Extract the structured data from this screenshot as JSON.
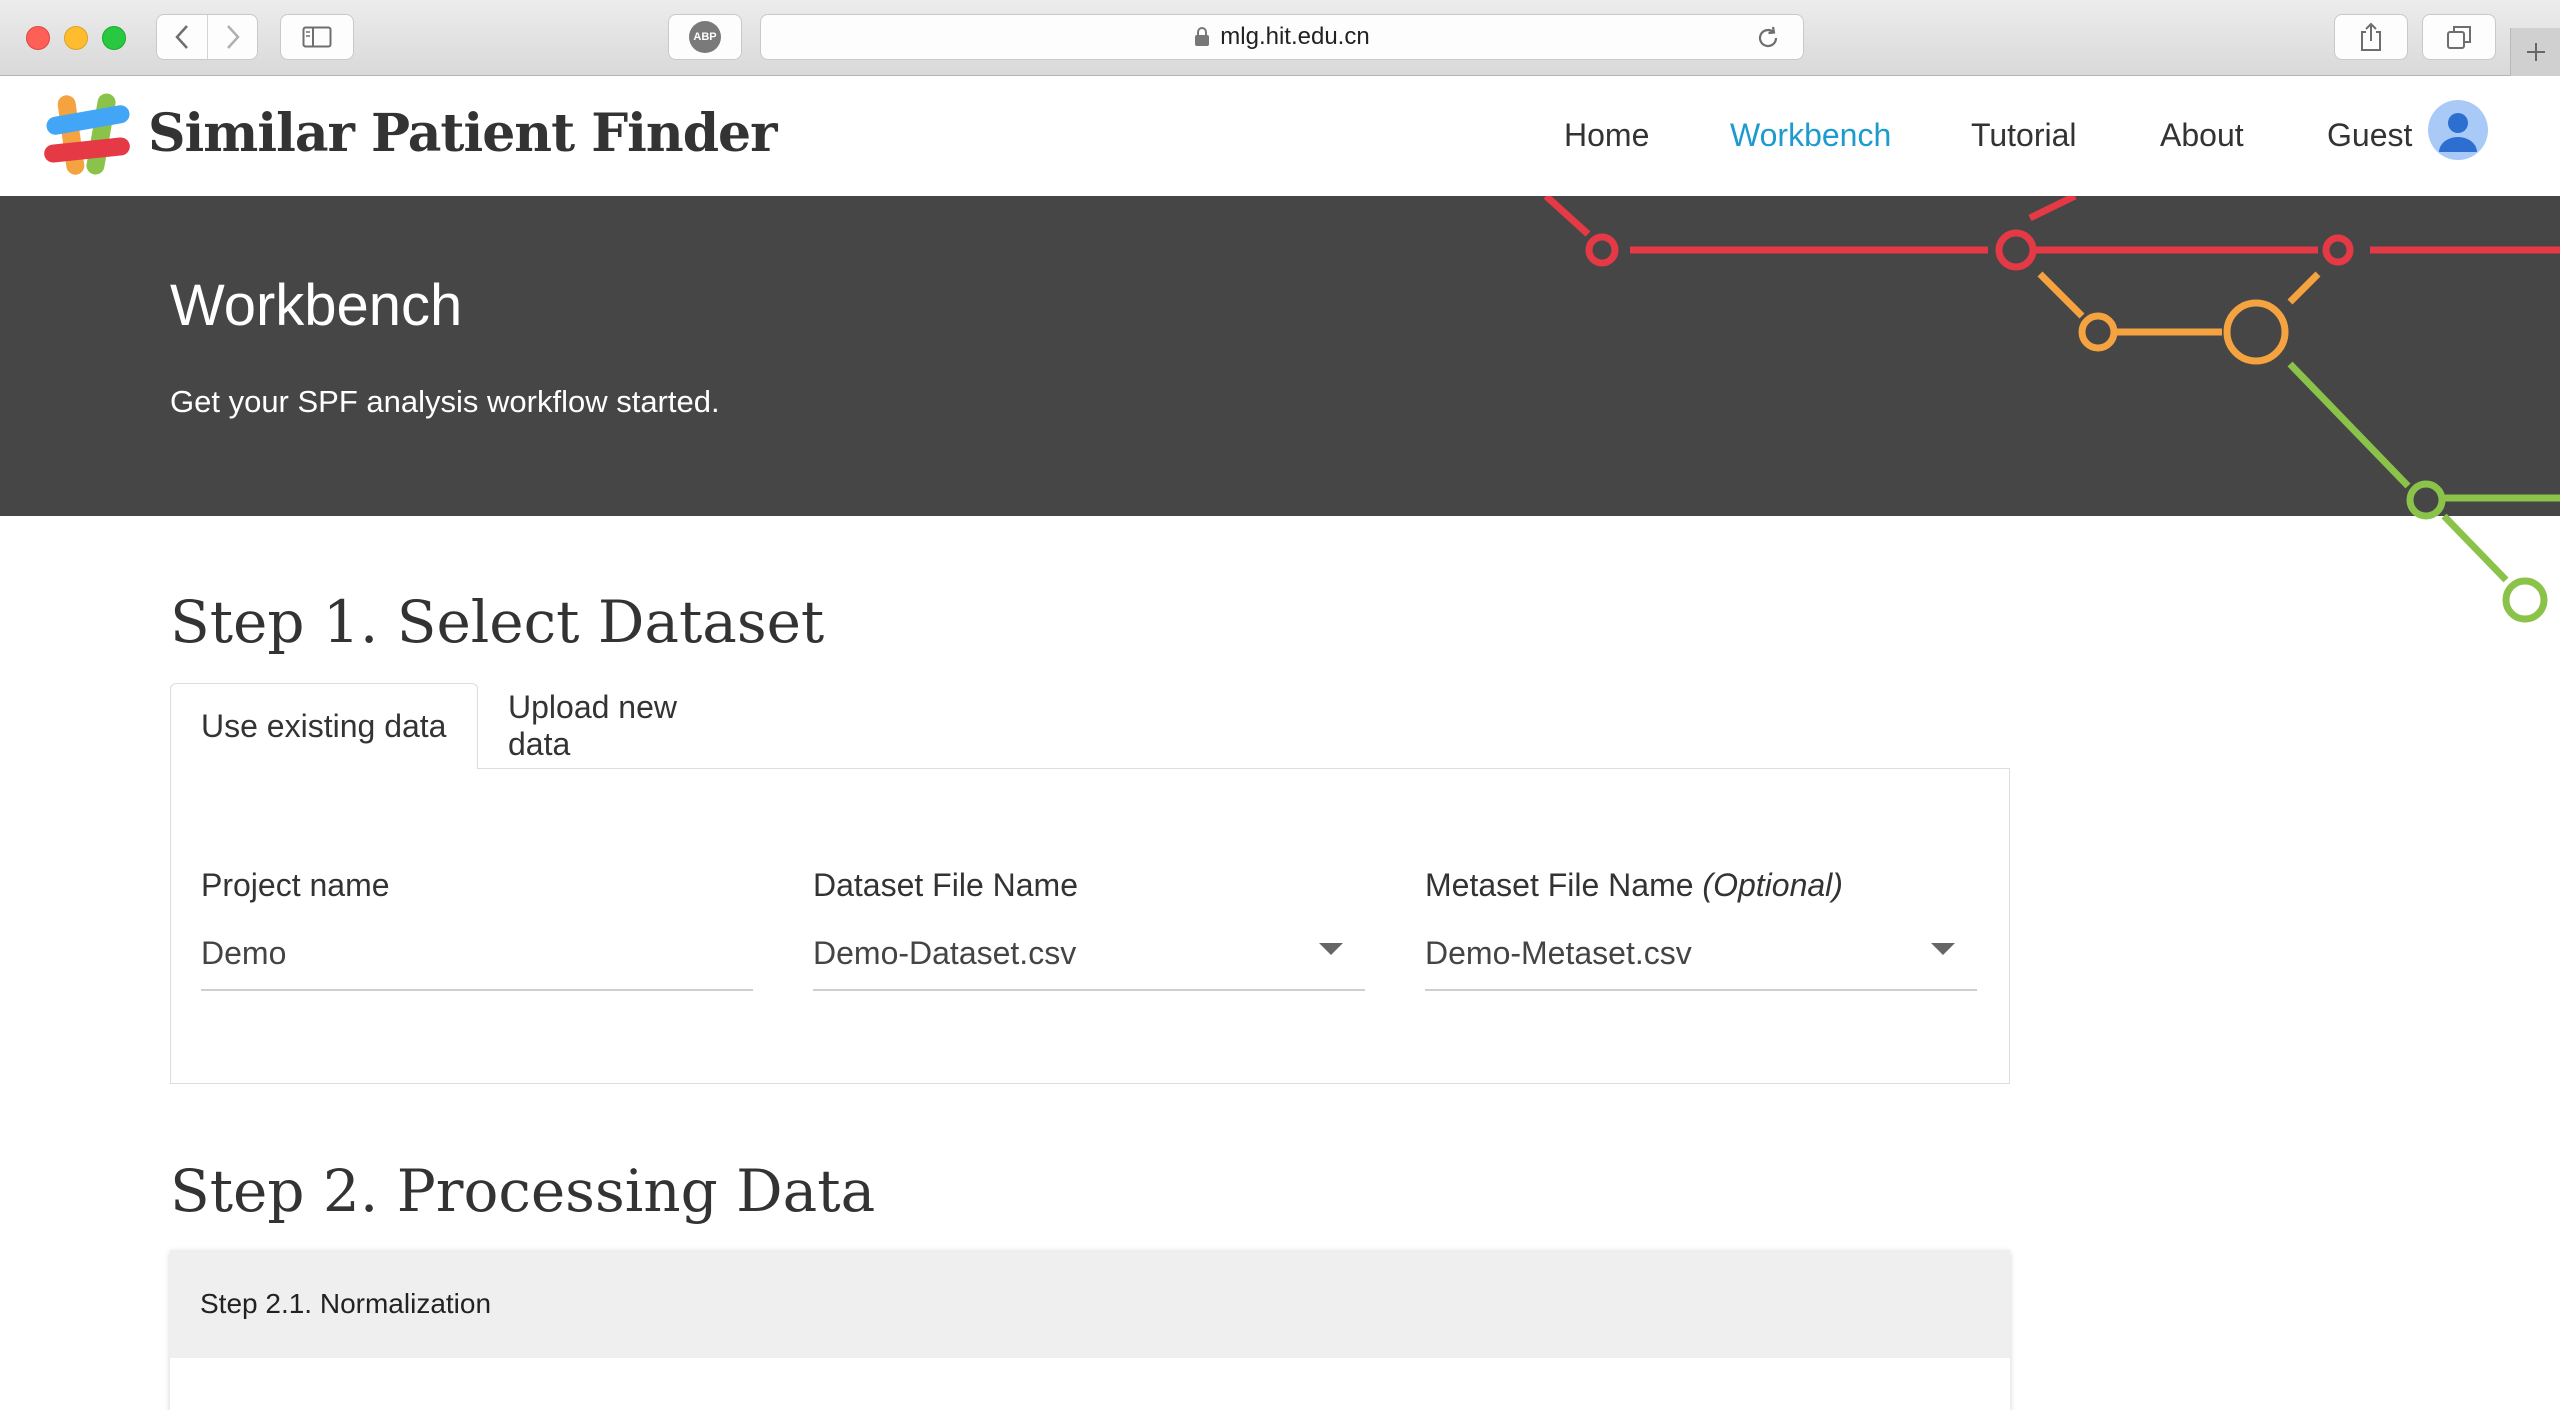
{
  "browser": {
    "url": "mlg.hit.edu.cn",
    "abp_label": "ABP"
  },
  "site": {
    "brand": "Similar Patient Finder",
    "nav": [
      {
        "label": "Home"
      },
      {
        "label": "Workbench",
        "active": true
      },
      {
        "label": "Tutorial"
      },
      {
        "label": "About"
      },
      {
        "label": "Guest"
      }
    ],
    "accent_color": "#1d9bd1"
  },
  "hero": {
    "title": "Workbench",
    "subtitle": "Get your SPF analysis workflow started."
  },
  "step1": {
    "title": "Step 1. Select Dataset",
    "tabs": [
      {
        "label": "Use existing data",
        "active": true
      },
      {
        "label": "Upload new data"
      }
    ],
    "fields": {
      "project": {
        "label": "Project name",
        "value": "Demo"
      },
      "dataset": {
        "label": "Dataset File Name",
        "value": "Demo-Dataset.csv"
      },
      "metaset": {
        "label": "Metaset File Name",
        "label_optional": "(Optional)",
        "value": "Demo-Metaset.csv"
      }
    }
  },
  "step2": {
    "title": "Step 2. Processing Data",
    "sub_title": "Step 2.1. Normalization"
  },
  "metro_colors": {
    "red": "#e63946",
    "orange": "#f4a340",
    "green": "#8bc34a"
  }
}
